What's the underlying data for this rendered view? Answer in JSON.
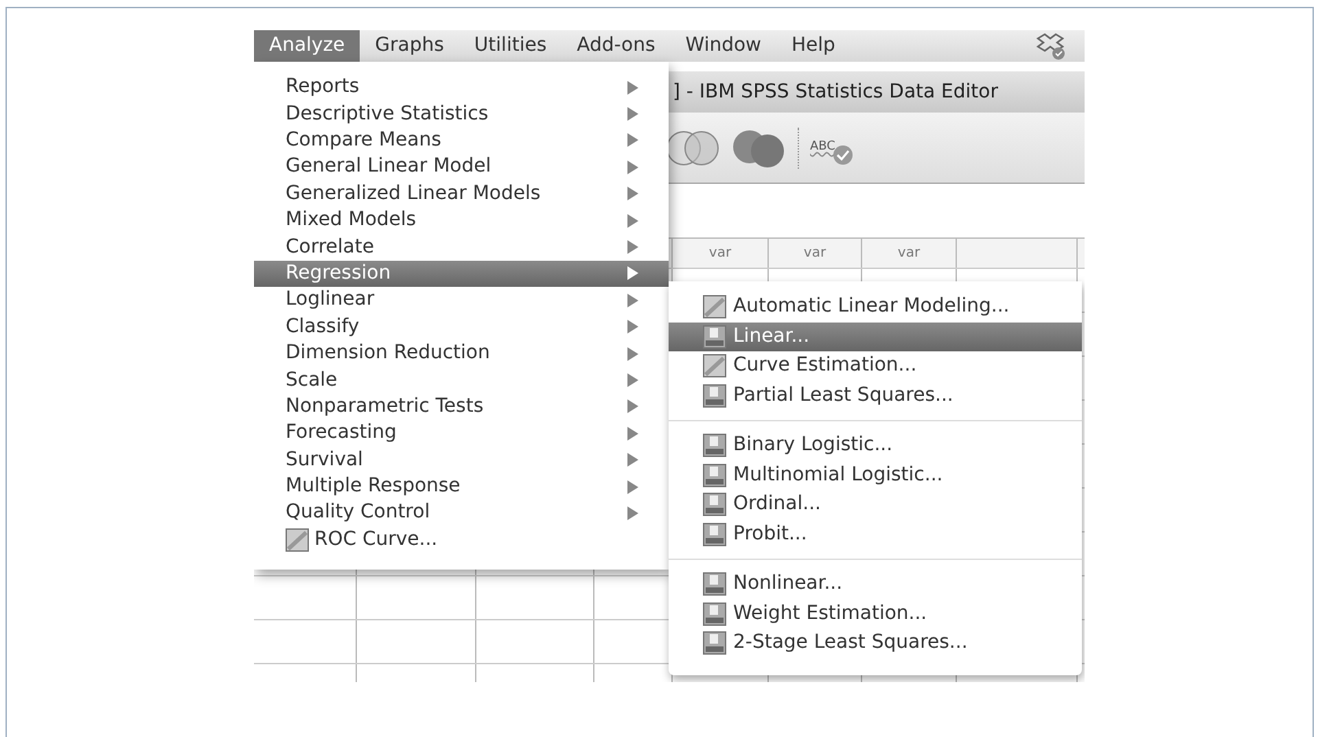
{
  "menubar": [
    {
      "label": "Analyze",
      "selected": true
    },
    {
      "label": "Graphs",
      "selected": false
    },
    {
      "label": "Utilities",
      "selected": false
    },
    {
      "label": "Add-ons",
      "selected": false
    },
    {
      "label": "Window",
      "selected": false
    },
    {
      "label": "Help",
      "selected": false
    }
  ],
  "window": {
    "title": "] - IBM SPSS Statistics Data Editor"
  },
  "toolbar": {
    "spell_label": "ABC"
  },
  "grid": {
    "columns": [
      "var",
      "var",
      "var"
    ]
  },
  "menu": {
    "items": [
      {
        "label": "Reports",
        "kind": "submenu",
        "selected": false
      },
      {
        "label": "Descriptive Statistics",
        "kind": "submenu",
        "selected": false
      },
      {
        "label": "Compare Means",
        "kind": "submenu",
        "selected": false
      },
      {
        "label": "General Linear Model",
        "kind": "submenu",
        "selected": false
      },
      {
        "label": "Generalized Linear Models",
        "kind": "submenu",
        "selected": false
      },
      {
        "label": "Mixed Models",
        "kind": "submenu",
        "selected": false
      },
      {
        "label": "Correlate",
        "kind": "submenu",
        "selected": false
      },
      {
        "label": "Regression",
        "kind": "submenu",
        "selected": true
      },
      {
        "label": "Loglinear",
        "kind": "submenu",
        "selected": false
      },
      {
        "label": "Classify",
        "kind": "submenu",
        "selected": false
      },
      {
        "label": "Dimension Reduction",
        "kind": "submenu",
        "selected": false
      },
      {
        "label": "Scale",
        "kind": "submenu",
        "selected": false
      },
      {
        "label": "Nonparametric Tests",
        "kind": "submenu",
        "selected": false
      },
      {
        "label": "Forecasting",
        "kind": "submenu",
        "selected": false
      },
      {
        "label": "Survival",
        "kind": "submenu",
        "selected": false
      },
      {
        "label": "Multiple Response",
        "kind": "submenu",
        "selected": false
      },
      {
        "label": "Quality Control",
        "kind": "submenu",
        "selected": false
      },
      {
        "label": "ROC Curve...",
        "kind": "chart",
        "selected": false
      }
    ]
  },
  "submenu": {
    "groups": [
      [
        {
          "label": "Automatic Linear Modeling...",
          "kind": "chart",
          "selected": false
        },
        {
          "label": "Linear...",
          "kind": "procedure",
          "selected": true
        },
        {
          "label": "Curve Estimation...",
          "kind": "chart",
          "selected": false
        },
        {
          "label": "Partial Least Squares...",
          "kind": "procedure",
          "selected": false
        }
      ],
      [
        {
          "label": "Binary Logistic...",
          "kind": "procedure",
          "selected": false
        },
        {
          "label": "Multinomial Logistic...",
          "kind": "procedure",
          "selected": false
        },
        {
          "label": "Ordinal...",
          "kind": "procedure",
          "selected": false
        },
        {
          "label": "Probit...",
          "kind": "procedure",
          "selected": false
        }
      ],
      [
        {
          "label": "Nonlinear...",
          "kind": "procedure",
          "selected": false
        },
        {
          "label": "Weight Estimation...",
          "kind": "procedure",
          "selected": false
        },
        {
          "label": "2-Stage Least Squares...",
          "kind": "procedure",
          "selected": false
        }
      ]
    ]
  }
}
